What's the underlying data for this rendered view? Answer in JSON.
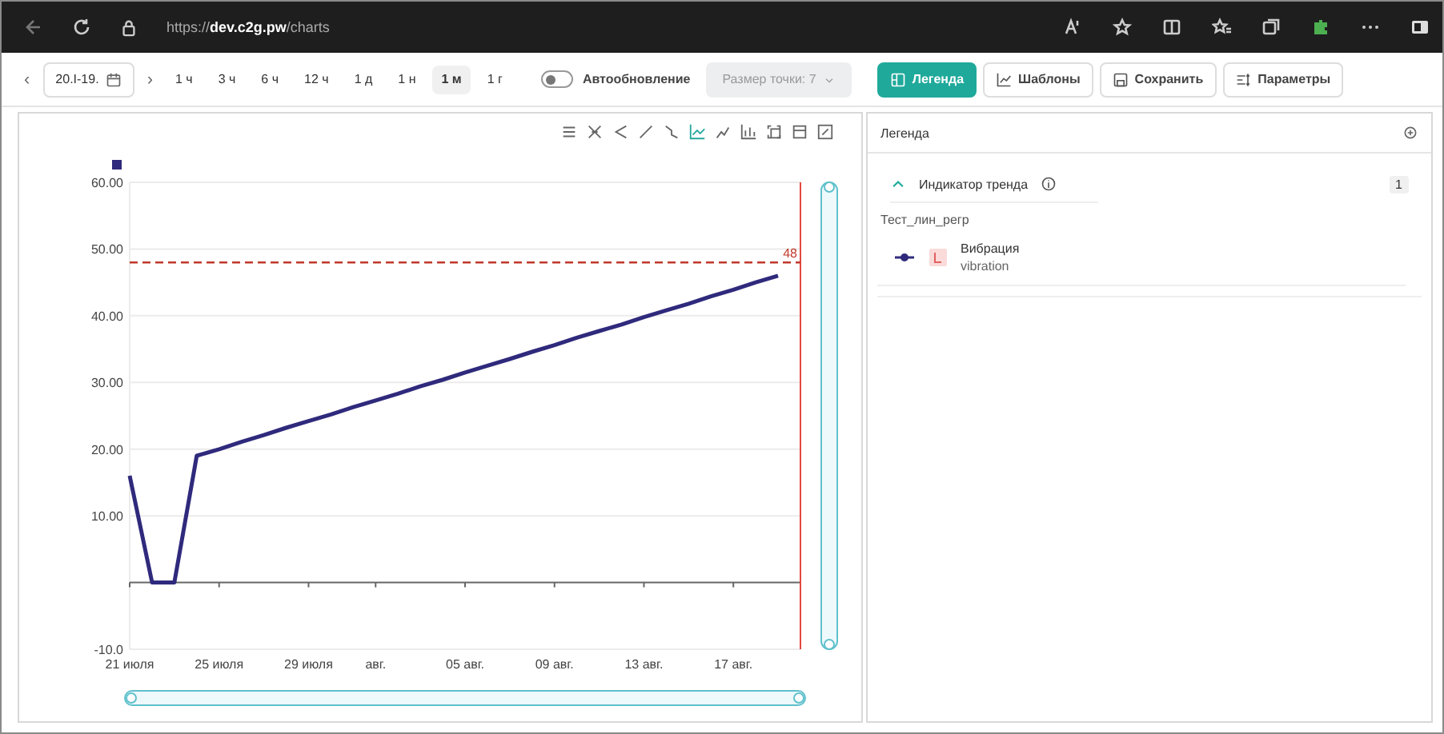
{
  "browser": {
    "url_prefix": "https://",
    "url_host": "dev.c2g.pw",
    "url_path": "/charts"
  },
  "toolbar": {
    "prev": "‹",
    "date_range": "20.I-19.",
    "next": "›",
    "periods": [
      {
        "label": "1 ч",
        "selected": false
      },
      {
        "label": "3 ч",
        "selected": false
      },
      {
        "label": "6 ч",
        "selected": false
      },
      {
        "label": "12 ч",
        "selected": false
      },
      {
        "label": "1 д",
        "selected": false
      },
      {
        "label": "1 н",
        "selected": false
      },
      {
        "label": "1 м",
        "selected": true
      },
      {
        "label": "1 г",
        "selected": false
      }
    ],
    "auto_refresh": {
      "label": "Автообновление",
      "on": false
    },
    "point_size": {
      "label": "Размер точки: 7",
      "disabled": true
    },
    "buttons": [
      {
        "label": "Легенда",
        "kind": "legend",
        "selected": true
      },
      {
        "label": "Шаблоны",
        "kind": "templates",
        "selected": false
      },
      {
        "label": "Сохранить",
        "kind": "save",
        "selected": false
      },
      {
        "label": "Параметры",
        "kind": "settings",
        "selected": false
      }
    ]
  },
  "chart_tools": [
    {
      "selected": false
    },
    {
      "selected": false
    },
    {
      "selected": false
    },
    {
      "selected": false
    },
    {
      "selected": false
    },
    {
      "selected": true
    },
    {
      "selected": false
    },
    {
      "selected": false
    },
    {
      "selected": false
    },
    {
      "selected": false
    },
    {
      "selected": false
    }
  ],
  "chart": {
    "chart_data": {
      "type": "line",
      "categories": [
        "21 июля",
        null,
        null,
        null,
        "25 июля",
        null,
        null,
        null,
        "29 июля",
        null,
        null,
        "авг.",
        null,
        null,
        null,
        "05 авг.",
        null,
        null,
        null,
        "09 авг.",
        null,
        null,
        null,
        "13 авг.",
        null,
        null,
        null,
        "17 авг.",
        null,
        null,
        null
      ],
      "series": [
        {
          "color": "#2f2a7c",
          "values": [
            16,
            0,
            0,
            19,
            20.0,
            21.1,
            22.1,
            23.2,
            24.2,
            25.2,
            26.3,
            27.3,
            28.3,
            29.4,
            30.4,
            31.5,
            32.5,
            33.5,
            34.6,
            35.6,
            36.7,
            37.7,
            38.7,
            39.8,
            40.8,
            41.8,
            42.9,
            43.9,
            45.0,
            46.0,
            null
          ]
        },
        {
          "name": "48",
          "color": "#c0392b",
          "line_style": "dashed",
          "values": [
            48,
            48,
            48,
            48,
            48,
            48,
            48,
            48,
            48,
            48,
            48,
            48,
            48,
            48,
            48,
            48,
            48,
            48,
            48,
            48,
            48,
            48,
            48,
            48,
            48,
            48,
            48,
            48,
            48,
            48,
            48
          ]
        }
      ],
      "ylim": [
        -10,
        60
      ],
      "grid": true,
      "yticks": [
        {
          "value": 60,
          "label": "60.00"
        },
        {
          "value": 50,
          "label": "50.00"
        },
        {
          "value": 40,
          "label": "40.00"
        },
        {
          "value": 30,
          "label": "30.00"
        },
        {
          "value": 20,
          "label": "20.00"
        },
        {
          "value": 10,
          "label": "10.00"
        },
        {
          "value": -10,
          "label": "-10.0"
        }
      ]
    }
  },
  "legend": {
    "title": "Легенда",
    "groups": [
      {
        "title": "Индикатор тренда",
        "expanded": true,
        "count": "1",
        "subtitle": "Тест_лин_регр",
        "items": [
          {
            "name": "Вибрация",
            "tag": "vibration",
            "color": "#2f2a7c"
          }
        ]
      }
    ]
  }
}
